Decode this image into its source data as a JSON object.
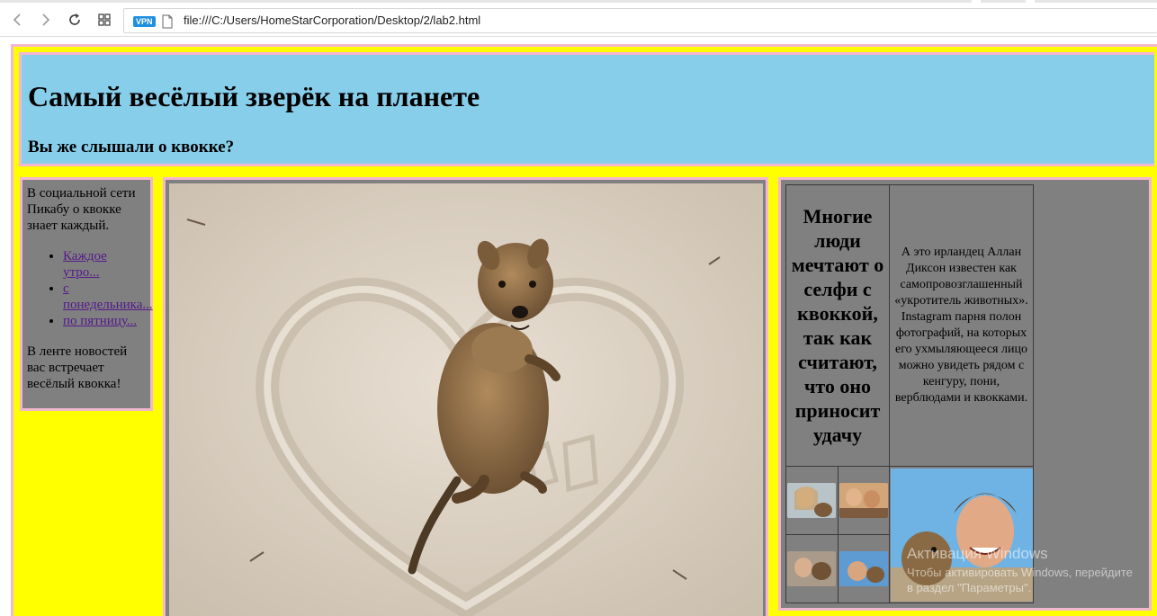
{
  "browser": {
    "url": "file:///C:/Users/HomeStarCorporation/Desktop/2/lab2.html",
    "vpn_badge": "VPN",
    "icons": [
      "back-icon",
      "forward-icon",
      "reload-icon",
      "apps-grid-icon",
      "file-icon"
    ]
  },
  "header": {
    "title": "Самый весёлый зверёк на планете",
    "subtitle": "Вы же слышали о квокке?"
  },
  "sidebar": {
    "intro": "В социальной сети Пикабу о квокке знает каждый.",
    "links": [
      "Каждое утро...",
      "с понедельника...",
      "по пятницу..."
    ],
    "outro": "В ленте новостей вас встречает весёлый квокка!"
  },
  "main": {
    "photo_alt": "Квокка на песке"
  },
  "aside": {
    "quote": "Многие люди мечтают о селфи с квоккой, так как считают, что оно приносит удачу",
    "story": "А это ирландец Аллан Диксон известен как самопровозглашенный «укротитель животных». Instagram парня полон фотографий, на которых его ухмыляющееся лицо можно увидеть рядом с кенгуру, пони, верблюдами и квокками."
  },
  "os_watermark": {
    "line1": "Активация Windows",
    "line2": "Чтобы активировать Windows, перейдите",
    "line3": "в раздел \"Параметры\"."
  },
  "colors": {
    "page_bg": "#ffff00",
    "header_bg": "#87ceeb",
    "block_bg": "#808080",
    "border": "#f5b6cf",
    "link": "#551a8b"
  }
}
